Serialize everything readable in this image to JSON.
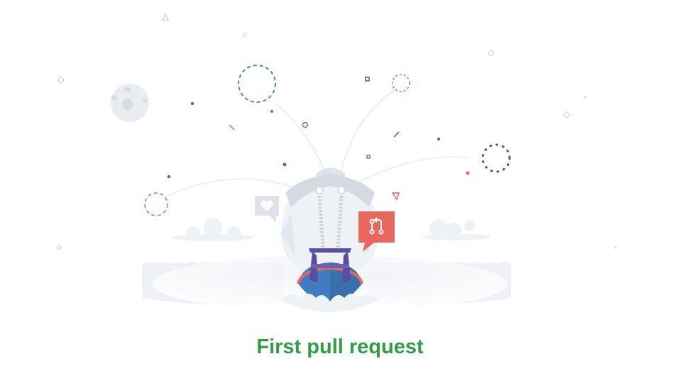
{
  "empty_state": {
    "title": "First pull request",
    "illustration": "rocket-ship-launch",
    "icons": [
      "heart-icon",
      "git-pull-request-icon",
      "moon-icon"
    ]
  },
  "colors": {
    "title": "#2f9e44",
    "accent_red": "#e8675f",
    "accent_blue": "#4a86c5",
    "accent_purple": "#5a4e9e",
    "ship_body": "#e9edf3",
    "water": "#f0f3f7"
  }
}
